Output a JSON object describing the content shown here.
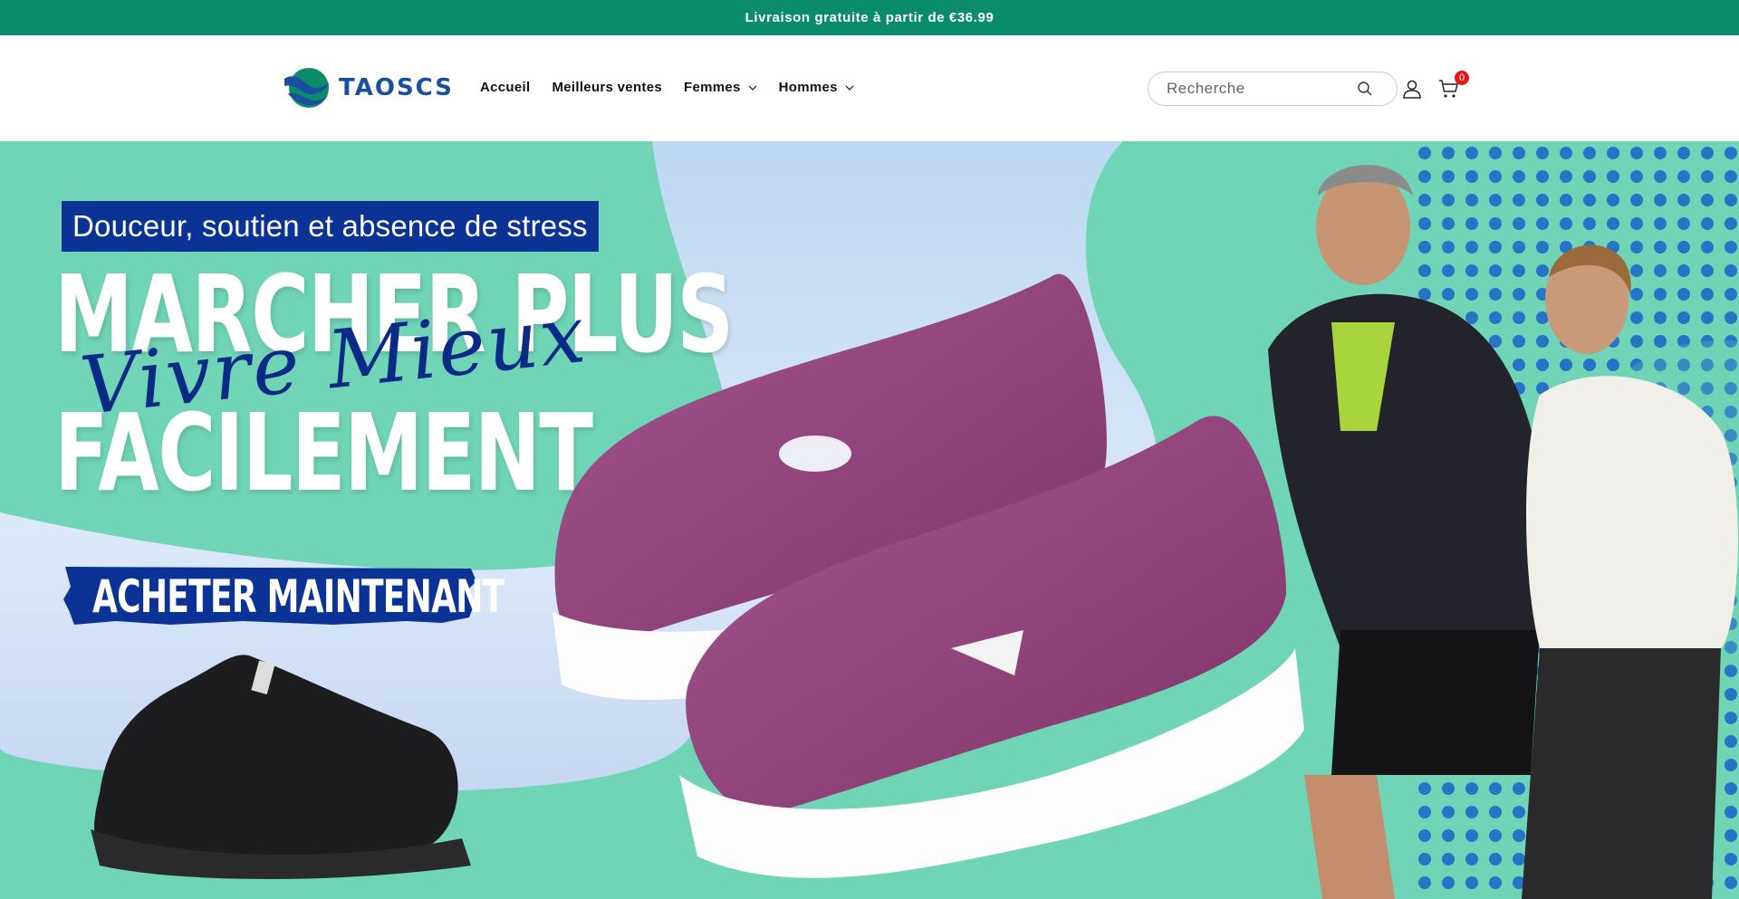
{
  "announcement": {
    "text": "Livraison gratuite à partir de €36.99"
  },
  "header": {
    "logo_text": "TAOSCS",
    "nav": [
      {
        "label": "Accueil",
        "has_dropdown": false
      },
      {
        "label": "Meilleurs ventes",
        "has_dropdown": false
      },
      {
        "label": "Femmes",
        "has_dropdown": true
      },
      {
        "label": "Hommes",
        "has_dropdown": true
      }
    ],
    "search": {
      "placeholder": "Recherche",
      "icon": "search-icon"
    },
    "account_icon": "user-icon",
    "cart": {
      "icon": "cart-icon",
      "count": "0"
    }
  },
  "hero": {
    "tagline": "Douceur, soutien et absence de stress",
    "headline_line1": "MARCHER PLUS",
    "headline_line2": "FACILEMENT",
    "script_text": "Vivre Mieux",
    "cta_label": "ACHETER MAINTENANT"
  },
  "colors": {
    "announcement_bg": "#0a8c6a",
    "hero_bg": "#6fd5b6",
    "tagline_bg": "#0b3396",
    "badge": "#e01818"
  }
}
